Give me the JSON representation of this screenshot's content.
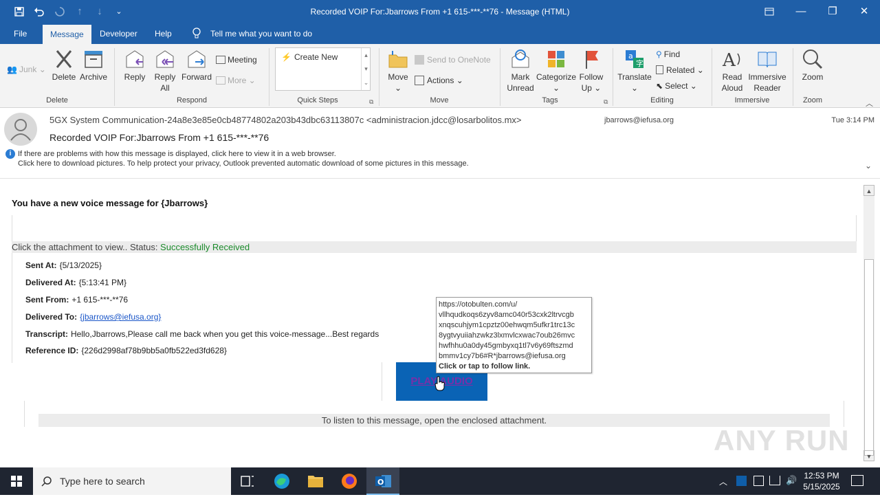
{
  "window": {
    "title": "Recorded VOIP For:Jbarrows From +1 615-***-**76  -  Message (HTML)"
  },
  "menu": {
    "tabs": [
      "File",
      "Message",
      "Developer",
      "Help"
    ],
    "active": "Message",
    "tell_me": "Tell me what you want to do"
  },
  "ribbon": {
    "delete_group": {
      "junk": "Junk",
      "delete": "Delete",
      "archive": "Archive",
      "label": "Delete"
    },
    "respond_group": {
      "reply": "Reply",
      "reply_all_1": "Reply",
      "reply_all_2": "All",
      "forward": "Forward",
      "meeting": "Meeting",
      "more": "More",
      "label": "Respond"
    },
    "quicksteps_group": {
      "create_new": "Create New",
      "label": "Quick Steps"
    },
    "move_group": {
      "move": "Move",
      "onenote": "Send to OneNote",
      "actions": "Actions",
      "label": "Move"
    },
    "tags_group": {
      "mark_1": "Mark",
      "mark_2": "Unread",
      "categorize": "Categorize",
      "follow_1": "Follow",
      "follow_2": "Up",
      "label": "Tags"
    },
    "editing_group": {
      "translate": "Translate",
      "find": "Find",
      "related": "Related",
      "select": "Select",
      "label": "Editing"
    },
    "immersive_group": {
      "read_1": "Read",
      "read_2": "Aloud",
      "imm_1": "Immersive",
      "imm_2": "Reader",
      "label": "Immersive"
    },
    "zoom_group": {
      "zoom": "Zoom",
      "label": "Zoom"
    }
  },
  "message": {
    "from": "5GX System Communication-24a8e3e85e0cb48774802a203b43dbc63113807c <administracion.jdcc@losarbolitos.mx>",
    "to": "jbarrows@iefusa.org",
    "time": "Tue 3:14 PM",
    "subject": "Recorded VOIP For:Jbarrows From +1 615-***-**76",
    "info_1": "If there are problems with how this message is displayed, click here to view it in a web browser.",
    "info_2": "Click here to download pictures. To help protect your privacy, Outlook prevented automatic download of some pictures in this message."
  },
  "body": {
    "heading": "You have a new voice message for {Jbarrows}",
    "status_prefix": "Click the attachment to view.. Status: ",
    "status_value": "Successfully Received",
    "status_color": "#1a8a2a",
    "fields": [
      {
        "label": "Sent At:",
        "value": "{5/13/2025}"
      },
      {
        "label": "Delivered At:",
        "value": "{5:13:41 PM}"
      },
      {
        "label": "Sent From:",
        "value": "+1 615-***-**76"
      },
      {
        "label": "Delivered To:",
        "value": "{jbarrows@iefusa.org}"
      },
      {
        "label": "Transcript:",
        "value": "Hello,Jbarrows,Please call me back when you get this voice-message...Best regards"
      },
      {
        "label": "Reference ID:",
        "value": "{226d2998af78b9bb5a0fb522ed3fd628}"
      }
    ],
    "play_button": "PLAY AUDIO",
    "play_button_color": "#0a63b5",
    "footer": "To listen to this message, open the enclosed attachment."
  },
  "tooltip": {
    "lines": [
      "https://otobulten.com/u/",
      "vllhqudkoqs6zyv8amc040r53cxk2ltrvcgb",
      "xnqscuhjym1cpztz00ehwqm5ufkr1trc13c",
      "8ygtvyuiiahzwkz3lxmvlcxwac7oub26mvc",
      "hwfhhu0a0dy45gmbyxq1tl7v6y69ftszmd",
      "bmmv1cy7b6#R*jbarrows@iefusa.org"
    ],
    "hint": "Click or tap to follow link."
  },
  "watermark": "ANY RUN",
  "taskbar": {
    "search_placeholder": "Type here to search",
    "time": "12:53 PM",
    "date": "5/15/2025"
  },
  "colors": {
    "titlebar": "#1f5fa8",
    "taskbar": "#1f2531"
  }
}
